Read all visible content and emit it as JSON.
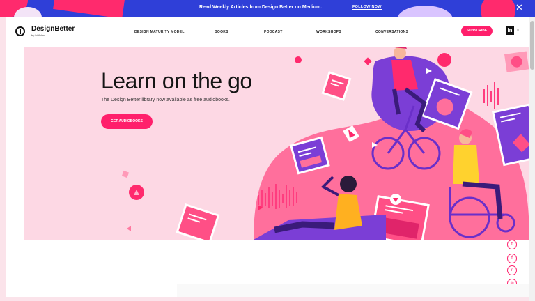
{
  "banner": {
    "text": "Read Weekly Articles from Design Better on Medium.",
    "link": "FOLLOW NOW",
    "close": "✕"
  },
  "header": {
    "brand": "DesignBetter",
    "brand_sub": "by InVision",
    "nav": [
      "DESIGN MATURITY MODEL",
      "BOOKS",
      "PODCAST",
      "WORKSHOPS",
      "CONVERSATIONS"
    ],
    "subscribe": "SUBSCRIBE",
    "account_logo": "in",
    "account_chevron": "⌄"
  },
  "hero": {
    "title": "Learn on the go",
    "lead": "The Design Better library now available as free audiobooks.",
    "cta": "GET AUDIOBOOKS"
  },
  "social": {
    "twitter": "t",
    "facebook": "f",
    "linkedin": "in",
    "link": "∞"
  },
  "colors": {
    "accent": "#ff1f6b",
    "banner_bg": "#2f3fd8",
    "hero_bg": "#fdd8e4",
    "purple": "#6a2fc9"
  }
}
